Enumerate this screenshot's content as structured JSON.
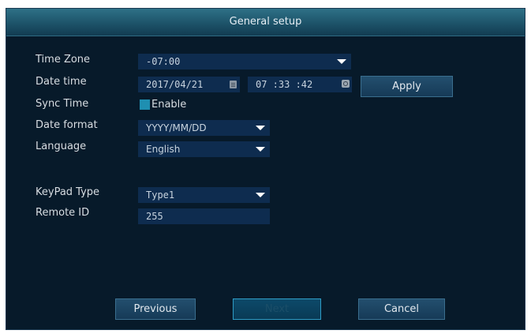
{
  "window": {
    "title": "General setup"
  },
  "form": {
    "time_zone": {
      "label": "Time Zone",
      "value": "-07:00"
    },
    "date_time": {
      "label": "Date time",
      "date_value": "2017/04/21",
      "time_value": "07 :33 :42",
      "apply_label": "Apply"
    },
    "sync_time": {
      "label": "Sync Time",
      "option_label": "Enable",
      "checked": true
    },
    "date_format": {
      "label": "Date format",
      "value": "YYYY/MM/DD"
    },
    "language": {
      "label": "Language",
      "value": "English"
    },
    "keypad_type": {
      "label": "KeyPad Type",
      "value": "Type1"
    },
    "remote_id": {
      "label": "Remote ID",
      "value": "255"
    }
  },
  "footer": {
    "previous_label": "Previous",
    "next_label": "Next",
    "cancel_label": "Cancel"
  },
  "colors": {
    "background": "#071a2a",
    "field": "#0e2c4f",
    "accent": "#1f8fb1",
    "titlebar": "#1d5369"
  }
}
